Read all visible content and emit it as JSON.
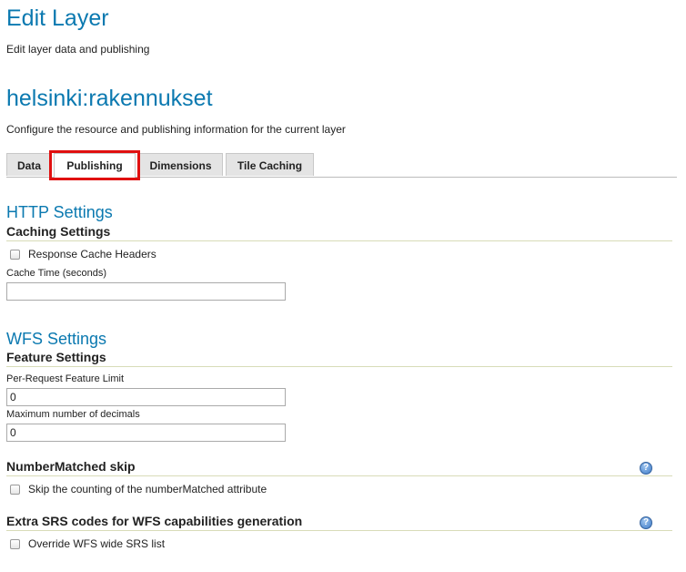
{
  "header": {
    "title": "Edit Layer",
    "description": "Edit layer data and publishing"
  },
  "layer": {
    "name": "helsinki:rakennukset",
    "description": "Configure the resource and publishing information for the current layer"
  },
  "tabs": [
    {
      "label": "Data",
      "active": false
    },
    {
      "label": "Publishing",
      "active": true
    },
    {
      "label": "Dimensions",
      "active": false
    },
    {
      "label": "Tile Caching",
      "active": false
    }
  ],
  "http_settings": {
    "title": "HTTP Settings",
    "caching_title": "Caching Settings",
    "response_cache_label": "Response Cache Headers",
    "response_cache_checked": false,
    "cache_time_label": "Cache Time (seconds)",
    "cache_time_value": ""
  },
  "wfs_settings": {
    "title": "WFS Settings",
    "feature_title": "Feature Settings",
    "feature_limit_label": "Per-Request Feature Limit",
    "feature_limit_value": "0",
    "max_decimals_label": "Maximum number of decimals",
    "max_decimals_value": "0",
    "number_matched_title": "NumberMatched skip",
    "number_matched_checkbox_label": "Skip the counting of the numberMatched attribute",
    "number_matched_checked": false,
    "extra_srs_title": "Extra SRS codes for WFS capabilities generation",
    "override_srs_label": "Override WFS wide SRS list",
    "override_srs_checked": false
  },
  "icons": {
    "help": "help-icon",
    "help_glyph": "?"
  },
  "colors": {
    "title": "#0b79b0",
    "highlight": "#e01010",
    "tab_bg": "#e4e4e4"
  }
}
